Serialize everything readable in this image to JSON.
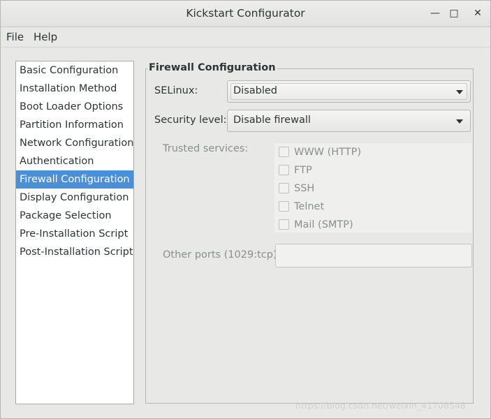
{
  "window": {
    "title": "Kickstart Configurator",
    "minimize": "—",
    "maximize": "□",
    "close": "✕"
  },
  "menubar": {
    "file": "File",
    "help": "Help"
  },
  "sidebar": {
    "items": [
      {
        "label": "Basic Configuration",
        "selected": false
      },
      {
        "label": "Installation Method",
        "selected": false
      },
      {
        "label": "Boot Loader Options",
        "selected": false
      },
      {
        "label": "Partition Information",
        "selected": false
      },
      {
        "label": "Network Configuration",
        "selected": false
      },
      {
        "label": "Authentication",
        "selected": false
      },
      {
        "label": "Firewall Configuration",
        "selected": true
      },
      {
        "label": "Display Configuration",
        "selected": false
      },
      {
        "label": "Package Selection",
        "selected": false
      },
      {
        "label": "Pre-Installation Script",
        "selected": false
      },
      {
        "label": "Post-Installation Script",
        "selected": false
      }
    ]
  },
  "firewall": {
    "frame_title": "Firewall Configuration",
    "selinux_label": "SELinux:",
    "selinux_value": "Disabled",
    "security_label": "Security level:",
    "security_value": "Disable firewall",
    "trusted_label": "Trusted services:",
    "services": [
      {
        "label": "WWW (HTTP)",
        "checked": false
      },
      {
        "label": "FTP",
        "checked": false
      },
      {
        "label": "SSH",
        "checked": false
      },
      {
        "label": "Telnet",
        "checked": false
      },
      {
        "label": "Mail (SMTP)",
        "checked": false
      }
    ],
    "other_ports_label": "Other ports (1029:tcp):",
    "other_ports_value": ""
  },
  "watermark": "https://blog.csdn.net/weixin_41708548",
  "colors": {
    "selection": "#4a90d9",
    "window_bg": "#e8e8e7",
    "disabled_text": "#8b8e8f"
  }
}
